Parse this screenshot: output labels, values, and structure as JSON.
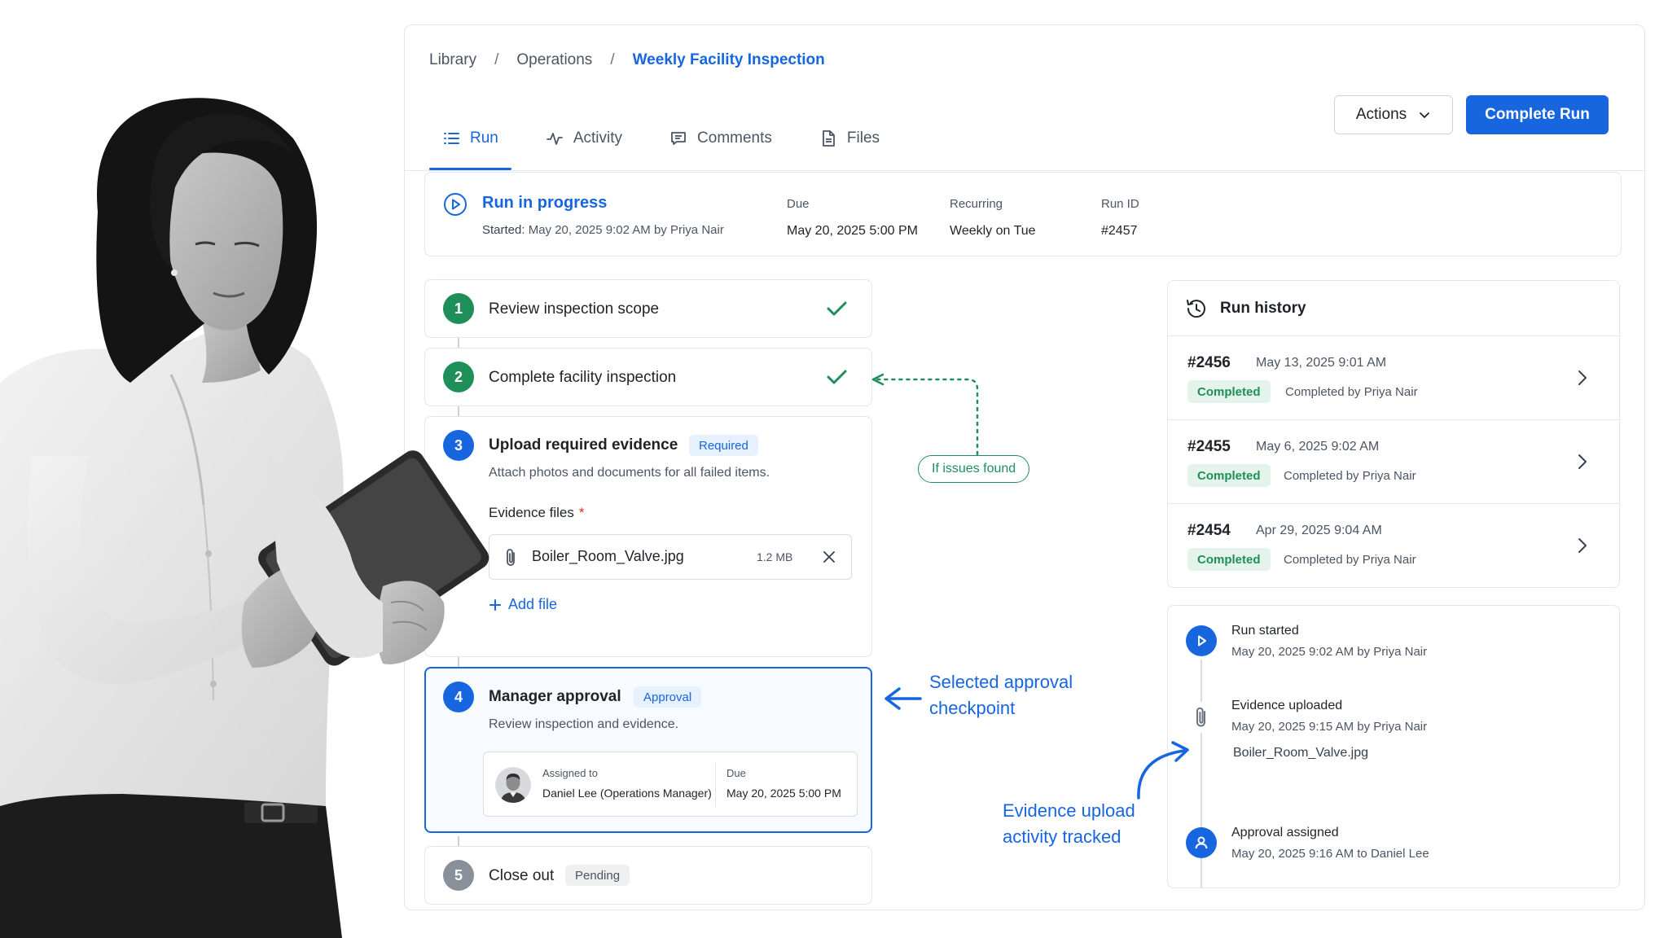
{
  "breadcrumb": {
    "items": [
      "Library",
      "Operations",
      "Weekly Facility Inspection"
    ],
    "separator": "/"
  },
  "tabs": [
    {
      "label": "Run",
      "icon": "list-icon",
      "active": true
    },
    {
      "label": "Activity",
      "icon": "activity-icon",
      "active": false
    },
    {
      "label": "Comments",
      "icon": "comment-icon",
      "active": false
    },
    {
      "label": "Files",
      "icon": "file-icon",
      "active": false
    }
  ],
  "toolbar": {
    "actions_label": "Actions",
    "complete_label": "Complete Run"
  },
  "status": {
    "title": "Run in progress",
    "started_label": "Started:",
    "started_value": "May 20, 2025 9:02 AM by Priya Nair",
    "due_label": "Due",
    "due_value": "May 20, 2025 5:00 PM",
    "recurring_label": "Recurring",
    "recurring_value": "Weekly on Tue",
    "runid_label": "Run ID",
    "runid_value": "#2457"
  },
  "steps": [
    {
      "num": "1",
      "title": "Review inspection scope",
      "state": "done"
    },
    {
      "num": "2",
      "title": "Complete facility inspection",
      "state": "done"
    },
    {
      "num": "3",
      "title": "Upload required evidence",
      "tag": "Required",
      "desc": "Attach photos and documents for all failed items.",
      "evidence_label": "Evidence files",
      "required_mark": "*",
      "file": {
        "name": "Boiler_Room_Valve.jpg",
        "size": "1.2 MB"
      },
      "add_file": "Add file"
    },
    {
      "num": "4",
      "title": "Manager approval",
      "tag": "Approval",
      "desc": "Review inspection and evidence.",
      "assigned_label": "Assigned to",
      "assigned_value": "Daniel Lee (Operations Manager)",
      "due_label": "Due",
      "due_value": "May 20, 2025 5:00 PM"
    },
    {
      "num": "5",
      "title": "Close out",
      "tag": "Pending"
    }
  ],
  "history": {
    "title": "Run history",
    "rows": [
      {
        "id": "#2456",
        "date": "May 13, 2025 9:01 AM",
        "status": "Completed",
        "by": "Completed by Priya Nair"
      },
      {
        "id": "#2455",
        "date": "May 6, 2025 9:02 AM",
        "status": "Completed",
        "by": "Completed by Priya Nair"
      },
      {
        "id": "#2454",
        "date": "Apr 29, 2025 9:04 AM",
        "status": "Completed",
        "by": "Completed by Priya Nair"
      }
    ]
  },
  "activity": [
    {
      "title": "Run started",
      "sub": "May 20, 2025 9:02 AM by Priya Nair",
      "icon": "play-icon"
    },
    {
      "title": "Evidence uploaded",
      "sub": "May 20, 2025 9:15 AM by Priya Nair",
      "file": "Boiler_Room_Valve.jpg",
      "icon": "paperclip-icon"
    },
    {
      "title": "Approval assigned",
      "sub": "May 20, 2025 9:16 AM to Daniel Lee",
      "icon": "user-icon"
    }
  ],
  "annotations": {
    "issues": "If issues found",
    "selected_line1": "Selected approval",
    "selected_line2": "checkpoint",
    "evidence_line1": "Evidence upload",
    "evidence_line2": "activity tracked"
  },
  "colors": {
    "accent": "#1766e0",
    "success": "#1f8f5a",
    "pending": "#8a9099"
  }
}
